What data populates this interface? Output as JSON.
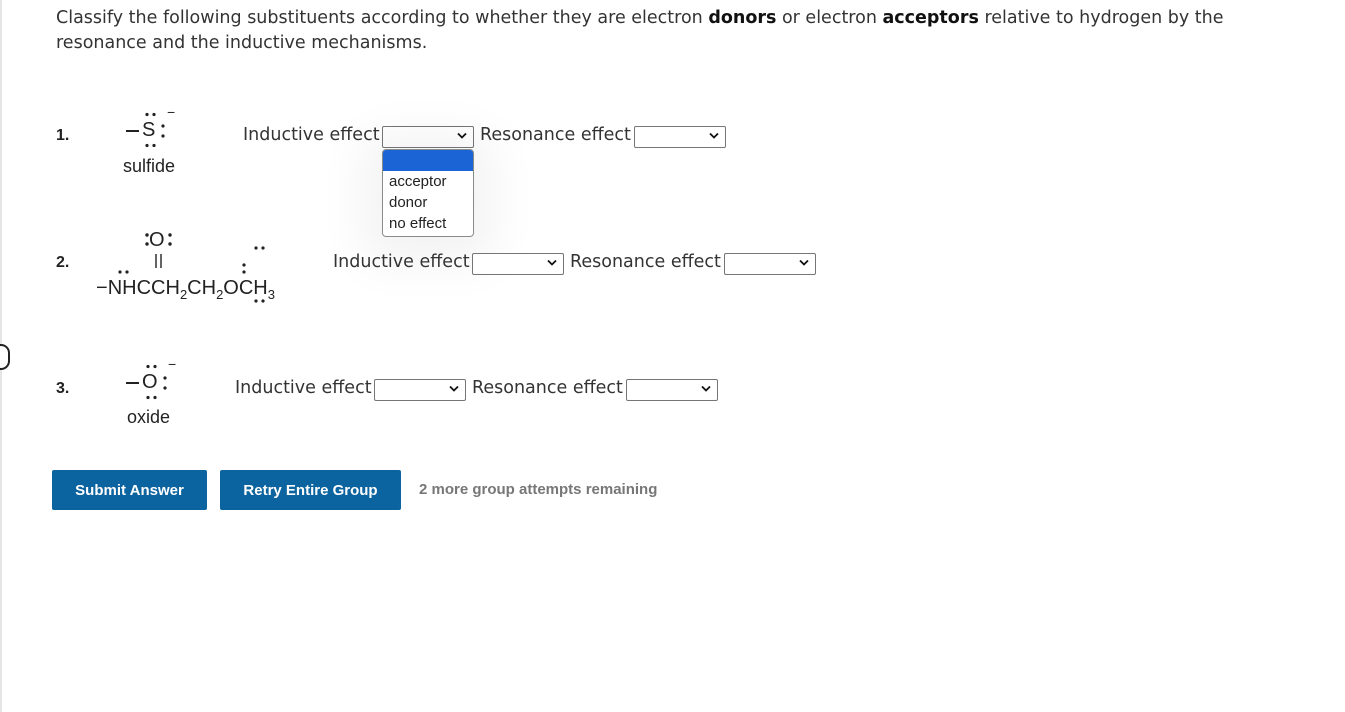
{
  "question": {
    "part1": "Classify the following substituents according to whether they are electron ",
    "donors": "donors",
    "part2": " or electron ",
    "acceptors": "acceptors",
    "part3": " relative to hydrogen by the resonance and the inductive mechanisms."
  },
  "items": [
    {
      "number": "1.",
      "caption": "sulfide",
      "atom": "S",
      "charge": "−",
      "inductive_label": "Inductive effect",
      "inductive_value": "",
      "resonance_label": "Resonance effect",
      "resonance_value": ""
    },
    {
      "number": "2.",
      "carbonyl_o": "O",
      "formula": {
        "dash": "−",
        "n": "N",
        "h": "H",
        "c1": "C",
        "ch2a": "CH",
        "sub2a": "2",
        "ch2b": "CH",
        "sub2b": "2",
        "o": "O",
        "ch3": "CH",
        "sub3": "3"
      },
      "inductive_label": "Inductive effect",
      "inductive_value": "",
      "resonance_label": "Resonance effect",
      "resonance_value": ""
    },
    {
      "number": "3.",
      "caption": "oxide",
      "atom": "O",
      "charge": "−",
      "inductive_label": "Inductive effect",
      "inductive_value": "",
      "resonance_label": "Resonance effect",
      "resonance_value": ""
    }
  ],
  "dropdown_options": [
    "",
    "acceptor",
    "donor",
    "no effect"
  ],
  "buttons": {
    "submit": "Submit Answer",
    "retry": "Retry Entire Group"
  },
  "attempts_text": "2 more group attempts remaining",
  "colors": {
    "button_bg": "#0b63a0",
    "option_highlight": "#1a64d6",
    "attempts_text": "#777777"
  }
}
